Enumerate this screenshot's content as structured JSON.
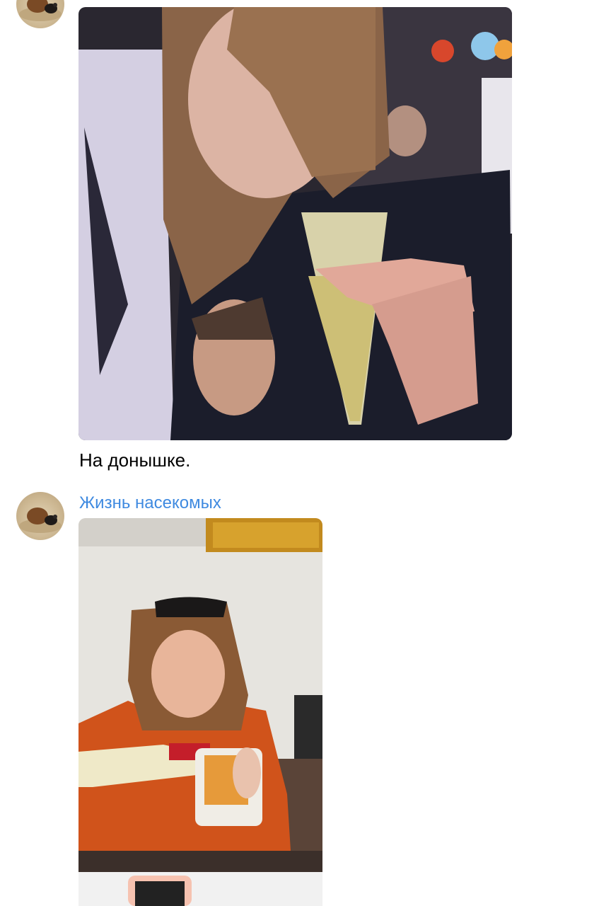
{
  "messages": [
    {
      "avatar_icon": "dung-beetle-avatar-icon",
      "photo_icon": "party-selfie-photo",
      "caption": "На донышке."
    },
    {
      "avatar_icon": "dung-beetle-avatar-icon",
      "sender": "Жизнь насекомых",
      "photo_icon": "woman-pouring-wine-photo"
    }
  ],
  "colors": {
    "sender_link": "#3f8ae0",
    "caption_text": "#000000",
    "background": "#ffffff"
  }
}
